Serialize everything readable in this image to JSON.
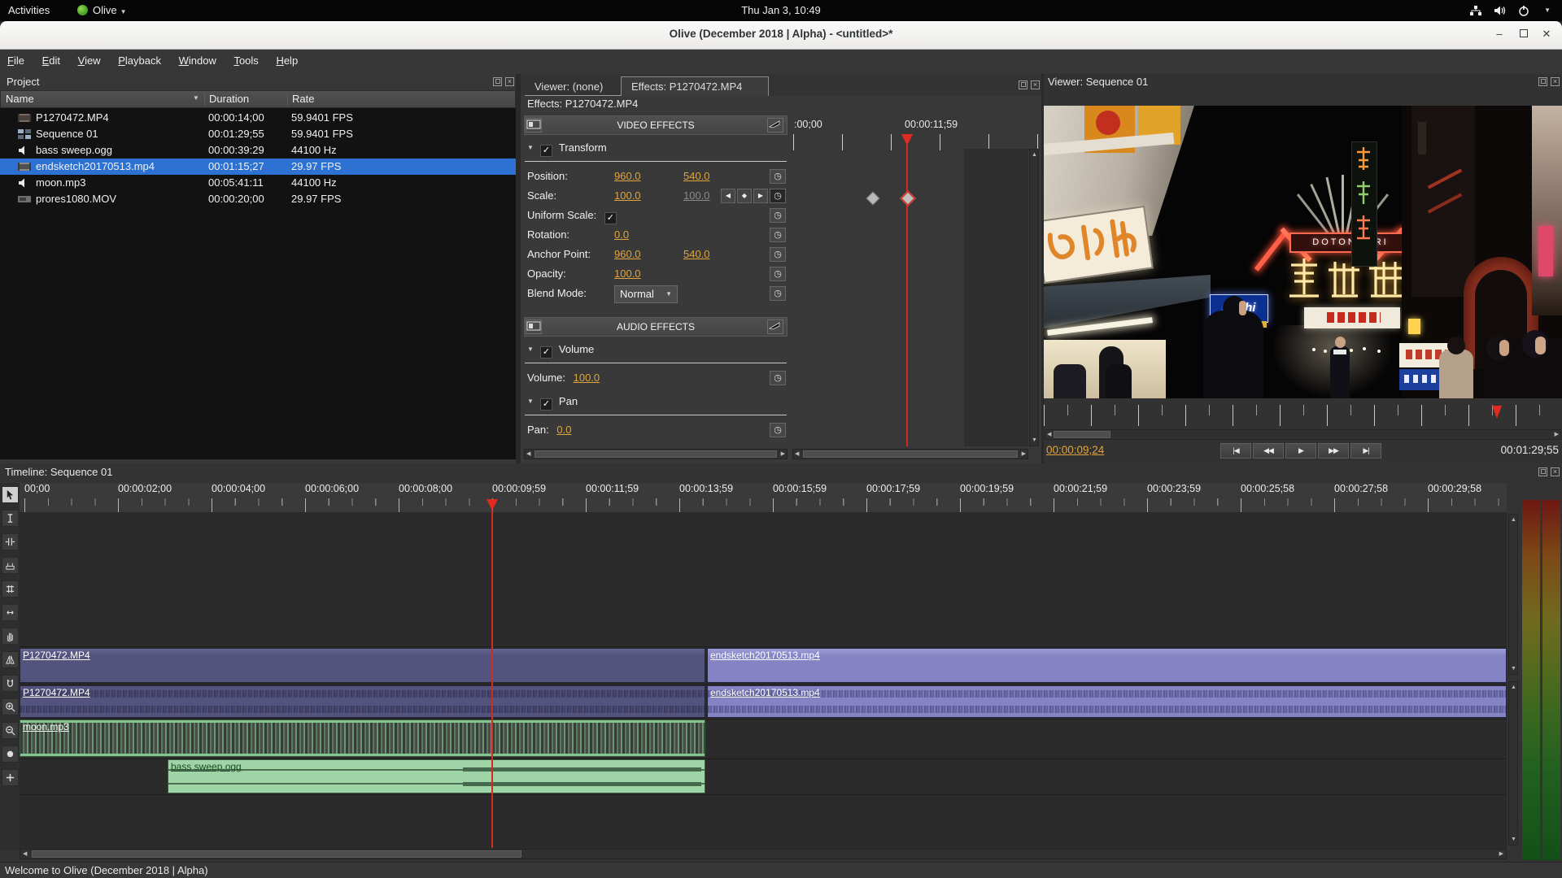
{
  "system_bar": {
    "activities_label": "Activities",
    "app_name": "Olive",
    "clock": "Thu Jan 3, 10:49"
  },
  "title_bar": {
    "title": "Olive (December 2018 | Alpha) - <untitled>*"
  },
  "menu_bar": {
    "items": [
      "File",
      "Edit",
      "View",
      "Playback",
      "Window",
      "Tools",
      "Help"
    ]
  },
  "project_panel": {
    "title": "Project",
    "columns": {
      "name": "Name",
      "duration": "Duration",
      "rate": "Rate"
    },
    "items": [
      {
        "type": "video",
        "name": "P1270472.MP4",
        "duration": "00:00:14;00",
        "rate": "59.9401 FPS"
      },
      {
        "type": "sequence",
        "name": "Sequence 01",
        "duration": "00:01:29;55",
        "rate": "59.9401 FPS"
      },
      {
        "type": "audio",
        "name": "bass sweep.ogg",
        "duration": "00:00:39:29",
        "rate": "44100 Hz"
      },
      {
        "type": "video",
        "name": "endsketch20170513.mp4",
        "duration": "00:01:15;27",
        "rate": "29.97 FPS",
        "selected": true
      },
      {
        "type": "audio",
        "name": "moon.mp3",
        "duration": "00:05:41:11",
        "rate": "44100 Hz"
      },
      {
        "type": "video",
        "name": "prores1080.MOV",
        "duration": "00:00:20;00",
        "rate": "29.97 FPS"
      }
    ]
  },
  "effects_panel": {
    "tabs": [
      {
        "label": "Viewer: (none)"
      },
      {
        "label": "Effects: P1270472.MP4"
      }
    ],
    "header": "Effects: P1270472.MP4",
    "video_effects_label": "VIDEO EFFECTS",
    "audio_effects_label": "AUDIO EFFECTS",
    "transform": {
      "name": "Transform",
      "rows": [
        {
          "label": "Position:",
          "v1": "960.0",
          "v2": "540.0"
        },
        {
          "label": "Scale:",
          "v1": "100.0",
          "v2": "100.0"
        },
        {
          "label": "Uniform Scale:"
        },
        {
          "label": "Rotation:",
          "v1": "0.0"
        },
        {
          "label": "Anchor Point:",
          "v1": "960.0",
          "v2": "540.0"
        },
        {
          "label": "Opacity:",
          "v1": "100.0"
        },
        {
          "label": "Blend Mode:",
          "dropdown": "Normal"
        }
      ]
    },
    "volume": {
      "name": "Volume",
      "label": "Volume:",
      "value": "100.0"
    },
    "pan": {
      "name": "Pan",
      "label": "Pan:",
      "value": "0.0"
    }
  },
  "keyframe_panel": {
    "ruler_labels": [
      ":00;00",
      "00:00:11;59"
    ]
  },
  "viewer_panel": {
    "title": "Viewer: Sequence 01",
    "current_time": "00:00:09;24",
    "end_time": "00:01:29;55",
    "signs": {
      "dotonbori": "DOTONBORI",
      "asahi": "Asahi",
      "noriba": "のりば",
      "kanji": "道頓堀"
    }
  },
  "timeline_panel": {
    "title": "Timeline: Sequence 01",
    "ruler_labels": [
      "00;00",
      "00:00:02;00",
      "00:00:04;00",
      "00:00:06;00",
      "00:00:08;00",
      "00:00:09;59",
      "00:00:11;59",
      "00:00:13;59",
      "00:00:15;59",
      "00:00:17;59",
      "00:00:19;59",
      "00:00:21;59",
      "00:00:23;59",
      "00:00:25;58",
      "00:00:27;58",
      "00:00:29;58"
    ],
    "tools": [
      "pointer",
      "edit",
      "ripple",
      "razor",
      "slip",
      "slide",
      "hand",
      "transition",
      "snap",
      "zoom-in",
      "zoom-out",
      "record",
      "add"
    ],
    "clips": {
      "video1": {
        "name": "P1270472.MP4"
      },
      "video2": {
        "name": "endsketch20170513.mp4"
      },
      "audio1": {
        "name": "P1270472.MP4"
      },
      "audio2": {
        "name": "endsketch20170513.mp4"
      },
      "audio3": {
        "name": "moon.mp3"
      },
      "audio4": {
        "name": "bass sweep.ogg"
      }
    }
  },
  "status_bar": {
    "message": "Welcome to Olive (December 2018 | Alpha)"
  },
  "colors": {
    "selection": "#2d72d2",
    "value_link": "#dfa53c",
    "playhead": "#e02b20",
    "clip_video_dark": "#54537d",
    "clip_video_light": "#8583c3",
    "clip_audio_green": "#85c491",
    "clip_audio_light_green": "#9ed4a6"
  }
}
